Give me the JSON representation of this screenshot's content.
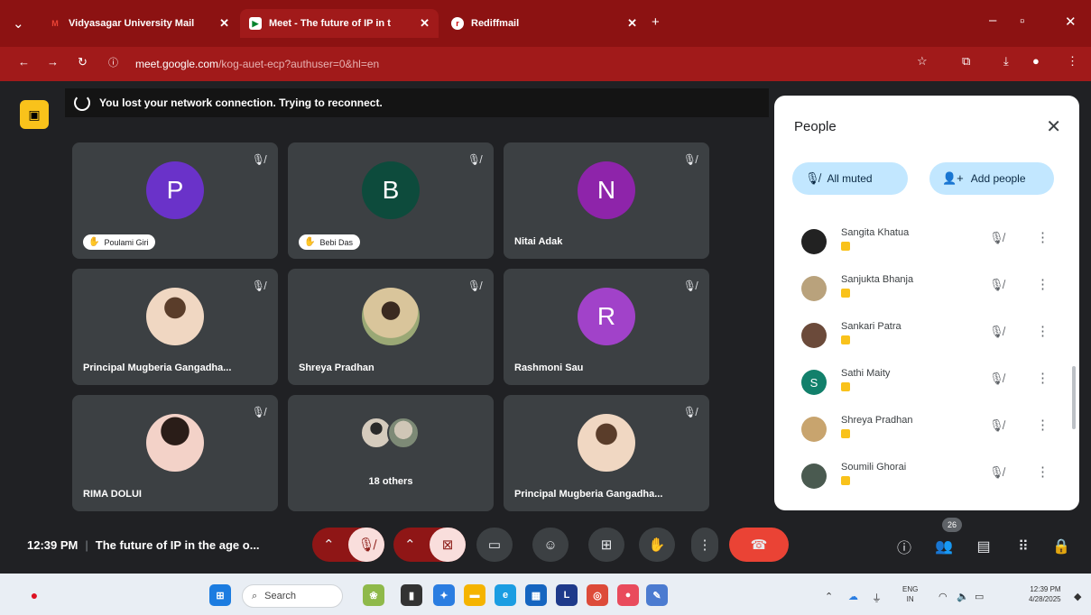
{
  "browser": {
    "tabs": [
      {
        "label": "Vidyasagar University Mail",
        "icon": "gmail-icon",
        "active": false
      },
      {
        "label": "Meet - The future of IP in t",
        "icon": "meet-icon",
        "active": true
      },
      {
        "label": "Rediffmail",
        "icon": "rediff-icon",
        "active": false
      }
    ],
    "new_tab": "+",
    "url_host": "meet.google.com",
    "url_path": "/kog-auet-ecp?authuser=0&hl=en"
  },
  "meet": {
    "reconnect_message": "You lost your network connection. Trying to reconnect.",
    "tiles": [
      {
        "name": "Poulami Giri",
        "initial": "P",
        "avatar_color": "#6a32c9",
        "pill": true
      },
      {
        "name": "Bebi Das",
        "initial": "B",
        "avatar_color": "#0d4b3c",
        "pill": true
      },
      {
        "name": "Nitai Adak",
        "initial": "N",
        "avatar_color": "#8e24aa",
        "pill": false
      },
      {
        "name": "Principal Mugberia Gangadha...",
        "initial": "",
        "avatar_color": "#a47a5a",
        "pill": false
      },
      {
        "name": "Shreya Pradhan",
        "initial": "",
        "avatar_color": "#c8a46e",
        "pill": false
      },
      {
        "name": "Rashmoni Sau",
        "initial": "R",
        "avatar_color": "#a142c9",
        "pill": false
      },
      {
        "name": "RIMA DOLUI",
        "initial": "",
        "avatar_color": "#d89a9a",
        "pill": false
      },
      {
        "name": "18 others",
        "initial": "",
        "avatar_color": "#6f7b84",
        "pill": false
      },
      {
        "name": "Principal Mugberia Gangadha...",
        "initial": "",
        "avatar_color": "#a47a5a",
        "pill": false
      }
    ],
    "time": "12:39 PM",
    "meeting_title": "The future of IP in the age o...",
    "participant_count": "26"
  },
  "people": {
    "title": "People",
    "all_muted_label": "All muted",
    "add_people_label": "Add people",
    "list": [
      {
        "name": "Sangita Khatua",
        "avatar_color": "#222222",
        "initial": ""
      },
      {
        "name": "Sanjukta Bhanja",
        "avatar_color": "#b9a27c",
        "initial": ""
      },
      {
        "name": "Sankari Patra",
        "avatar_color": "#6b4a3a",
        "initial": ""
      },
      {
        "name": "Sathi Maity",
        "avatar_color": "#12806b",
        "initial": "S"
      },
      {
        "name": "Shreya Pradhan",
        "avatar_color": "#c8a46e",
        "initial": ""
      },
      {
        "name": "Soumili Ghorai",
        "avatar_color": "#4a5a50",
        "initial": ""
      }
    ]
  },
  "taskbar": {
    "search_placeholder": "Search",
    "lang_line1": "ENG",
    "lang_line2": "IN",
    "clock_time": "12:39 PM",
    "clock_date": "4/28/2025"
  }
}
